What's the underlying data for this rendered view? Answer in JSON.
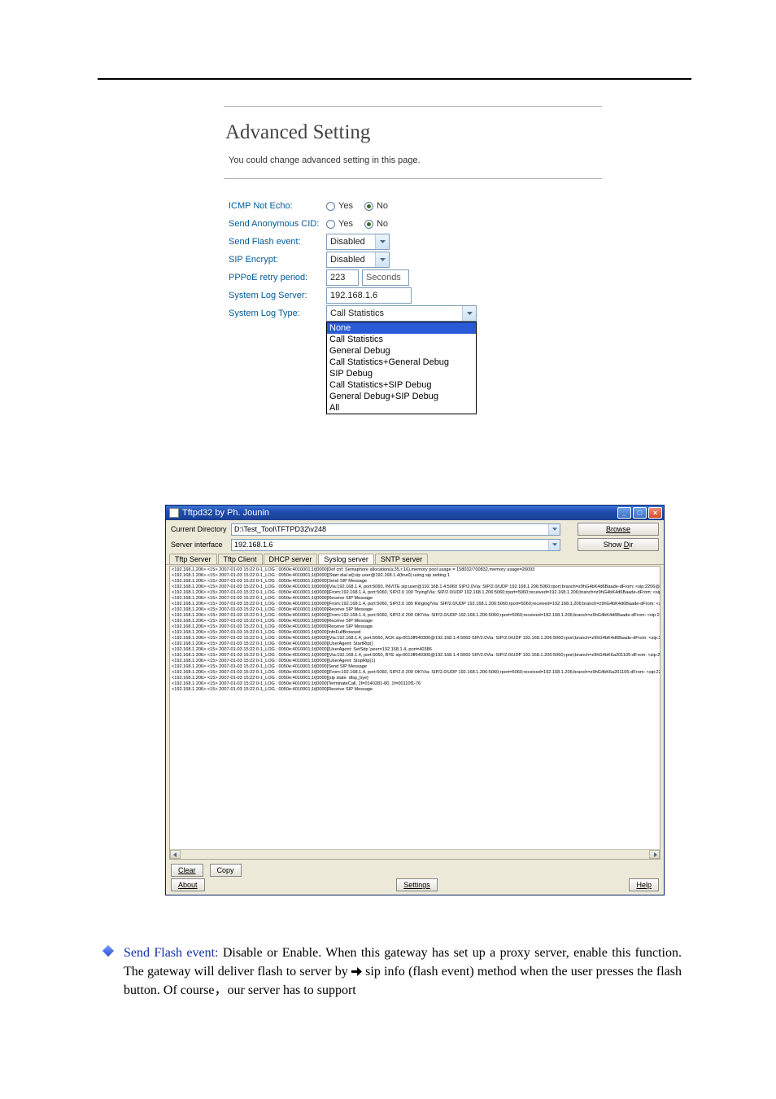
{
  "panel": {
    "title": "Advanced Setting",
    "subtitle": "You could change advanced setting in this page.",
    "rows": {
      "icmp": {
        "label": "ICMP Not Echo:",
        "yes": "Yes",
        "no": "No"
      },
      "anon": {
        "label": "Send Anonymous CID:",
        "yes": "Yes",
        "no": "No"
      },
      "flash": {
        "label": "Send Flash event:",
        "value": "Disabled"
      },
      "sip": {
        "label": "SIP Encrypt:",
        "value": "Disabled"
      },
      "pppoe": {
        "label": "PPPoE retry period:",
        "value": "223",
        "unit": "Seconds"
      },
      "syslogsrv": {
        "label": "System Log Server:",
        "value": "192.168.1.6"
      },
      "syslogtype": {
        "label": "System Log Type:",
        "value": "Call Statistics"
      }
    },
    "dropdown": [
      "None",
      "Call Statistics",
      "General Debug",
      "Call Statistics+General Debug",
      "SIP Debug",
      "Call Statistics+SIP Debug",
      "General Debug+SIP Debug",
      "All"
    ]
  },
  "tftp": {
    "title": "Tftpd32 by Ph. Jounin",
    "curdir_label": "Current Directory",
    "curdir_value": "D:\\Test_Tool\\TFTPD32\\v248",
    "iface_label": "Server interface",
    "iface_value": "192.168.1.6",
    "browse": "Browse",
    "showdir": "Show Dir",
    "tabs": [
      "Tftp Server",
      "Tftp Client",
      "DHCP server",
      "Syslog server",
      "SNTP server"
    ],
    "loglines": [
      "<192.168.1.206> <15> 2007-01-03 15:22 0-1_LOG : 0050e:4010001;1t[0000]Def cnf: Semaphore allocation(a:35,r:16),memory pool usage = 158032/700832,memory usage=26093",
      "<192.168.1.206> <15> 2007-01-03 15:22 0-1_LOG : 0050e:4010001;1t[0000][Start dial at]:sip user@192.168.1.4(line0) using sip setting 1",
      "<192.168.1.206> <15> 2007-01-03 15:22 0-1_LOG : 0050e:4010001;1t[0000]Send SIP Message",
      "<192.168.1.206> <15> 2007-01-03 15:22 0-1_LOG : 0050e:4010001;1t[0000][Via:192.168.1.4, port:5060, INVITE sip:user@192.168.1.4:5060 SIP/2.0Via: SIP/2.0/UDP 192.168.1.206:5060;rport;branch=z9hG4bK4d6Baade-dFrom: <sip:2206@192.168.1.206:5060>;tag=20",
      "<192.168.1.206> <15> 2007-01-03 15:22 0-1_LOG : 0050e:4010001;1t[0000][From:192.168.1.4, port:5060, SIP/2.0 100 Trying!Via: SIP/2.0/UDP 192.168.1.206:5060;rport=5060;received=192.168.1.206;branch=z9hG4bK4d6Baade-dFrom: <sip:2206@192.168.1.206:1",
      "<192.168.1.206> <15> 2007-01-03 15:22 0-1_LOG : 0050e:4010001;1t[0000]Receive SIP Message",
      "<192.168.1.206> <15> 2007-01-03 15:22 0-1_LOG : 0050e:4010001;1t[0000][From:192.168.1.4, port:5060, SIP/2.0 180 Ringing!Via: SIP/2.0/UDP 192.168.1.206:5060;rport=5060;received=192.168.1.206;branch=z9hG4bK4d6Baade-dFrom: <sip:2206@192.168.1.206:",
      "<192.168.1.206> <15> 2007-01-03 15:22 0-1_LOG : 0050e:4010001;1t[0000]Receive SIP Message",
      "<192.168.1.206> <15> 2007-01-03 15:22 0-1_LOG : 0050e:4010001;1t[0000][From:192.168.1.4, port:5060, SIP/2.0 200 OK!Via: SIP/2.0/UDP 192.168.1.206:5060;rport=5060;received=192.168.1.206;branch=z9hG4bK4d6Baade-dFrom: <sip:2206@192.168.1.206:506",
      "<192.168.1.206> <15> 2007-01-03 15:22 0-1_LOG : 0050e:4010001;1t[0000]Receive SIP Message",
      "<192.168.1.206> <15> 2007-01-03 15:22 0-1_LOG : 0050e:4010001;1t[0000]Receive SIP Message",
      "<192.168.1.206> <15> 2007-01-03 15:22 0-1_LOG : 0050e:4010001;1t[0000]InfoFullBrowsed",
      "<192.168.1.206> <15> 2007-01-03 15:22 0-1_LOG : 0050e:4010001;1t[0000][Via:192.168.1.4, port:5060, ACK sip:0013ff640300@192.168.1.4:5060 SIP/2.0Via: SIP/2.0/UDP 192.168.1.206:5060;rport;branch=z9hG4bK4d6Baade-dFrom: <sip:2206@192.168.1.206:50",
      "<192.168.1.206> <15> 2007-01-03 15:22 0-1_LOG : 0050e:4010001;1t[0000][UserAgent: StartRtp()",
      "<192.168.1.206> <15> 2007-01-03 15:22 0-1_LOG : 0050e:4010001;1t[0000][UserAgent: SetSdp 'peer=192.168.1.4, port=40386",
      "<192.168.1.206> <15> 2007-01-03 15:22 0-1_LOG : 0050e:4010001;1t[0000][Via:192.168.1.4, port:5060, BYE sip:0013ff640300@192.168.1.4:5060 SIP/2.0Via: SIP/2.0/UDP 192.168.1.206:5060;rport;branch=z9hG4bK6a201105-dFrom: <sip:2206@192.168.1.206:506",
      "<192.168.1.206> <15> 2007-01-03 15:22 0-1_LOG : 0050e:4010001;1t[0000][UserAgent: StopRtp(1)",
      "<192.168.1.206> <15> 2007-01-03 15:22 0-1_LOG : 0050e:4010001;1t[0000]Send SIP Message",
      "<192.168.1.206> <15> 2007-01-03 15:22 0-1_LOG : 0050e:4010001;1t[0000][From:192.168.1.4, port:5060, SIP/2.0 200 OK!Via: SIP/2.0/UDP 192.168.1.206:5060;rport=5060;received=192.168.1.206;branch=z9hG4bK6a201105-dFrom: <sip:2206@192.168.1.206:5060",
      "<192.168.1.206> <15> 2007-01-03 15:22 0-1_LOG : 0050e:4010001;1t[0000][sip state: dlsp_bye]",
      "<192.168.1.206> <15> 2007-01-03 15:22 0-1_LOG : 0050e:4010001;1t[0000]TerminateCall, 1f=0140281-80, 1f=00110f1-76",
      "<192.168.1.206> <15> 2007-01-03 15:22 0-1_LOG : 0050e:4010001;1t[0000]Receive SIP Message"
    ],
    "buttons": {
      "clear": "Clear",
      "copy": "Copy",
      "about": "About",
      "settings": "Settings",
      "help": "Help"
    }
  },
  "bullet": {
    "lead": "Send Flash event: ",
    "body1": "Disable or Enable. When this gateway has set up a proxy server, enable this function. The gateway will deliver flash to server by ",
    "sip_info": "sip info",
    "body2": " (flash event) method when the user presses the flash button. Of course，our server has to support "
  }
}
